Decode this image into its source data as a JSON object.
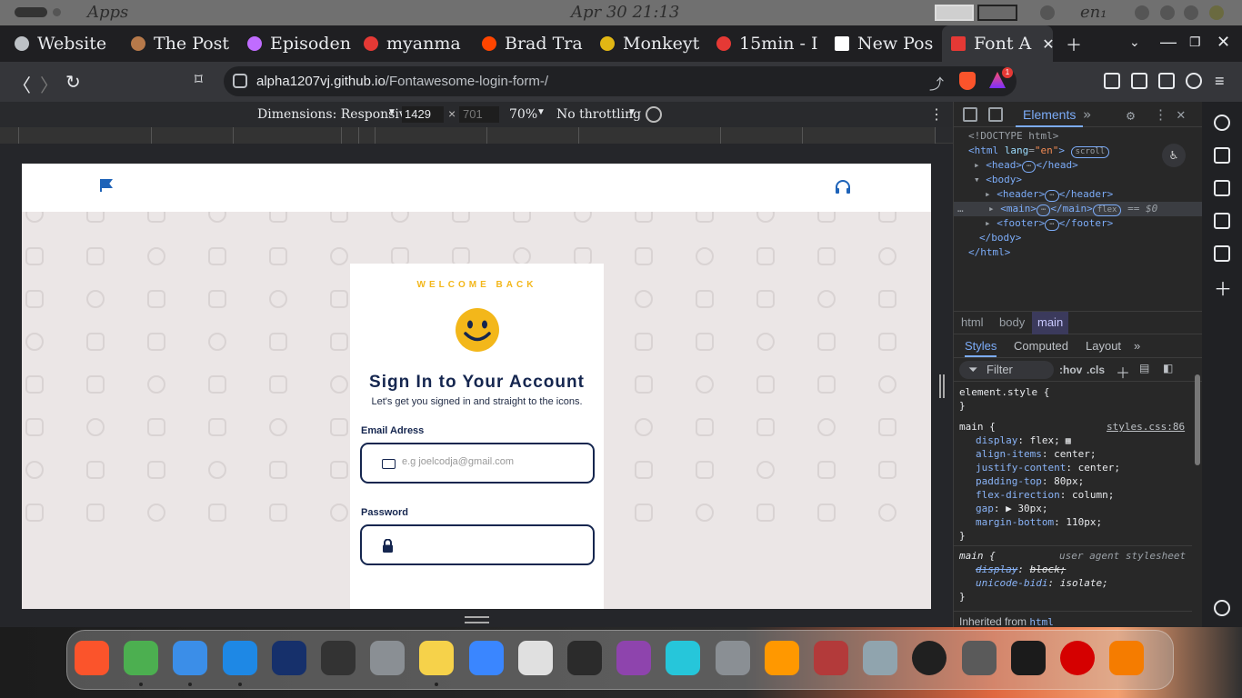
{
  "system_bar": {
    "apps_label": "Apps",
    "datetime": "Apr 30  21:13",
    "lang": "en₁"
  },
  "tabs": [
    {
      "label": "Website",
      "icon": "website-icon",
      "color": "#bdc1c6"
    },
    {
      "label": "The Post",
      "icon": "monkey-icon",
      "color": "#b6794a"
    },
    {
      "label": "Episoden",
      "icon": "infinity-icon",
      "color": "#c06cff"
    },
    {
      "label": "myanma",
      "icon": "shield-icon",
      "color": "#e53935"
    },
    {
      "label": "Brad Tra",
      "icon": "reddit-icon",
      "color": "#ff4500"
    },
    {
      "label": "Monkeyt",
      "icon": "monkeytype-icon",
      "color": "#e2b714"
    },
    {
      "label": "15min - I",
      "icon": "shield-icon",
      "color": "#e53935"
    },
    {
      "label": "New Pos",
      "icon": "dev-icon",
      "color": "#ffffff"
    },
    {
      "label": "Font A",
      "icon": "font-icon",
      "color": "#e53935",
      "active": true
    }
  ],
  "address": {
    "host": "alpha1207vj.github.io",
    "path": "/Fontawesome-login-form-/",
    "badge_count": "1"
  },
  "device_toolbar": {
    "dimensions_label": "Dimensions: Responsive",
    "width": "1429",
    "height_placeholder": "701",
    "zoom": "70%",
    "throttling": "No throttling"
  },
  "page": {
    "welcome": "WELCOME BACK",
    "title": "Sign In to Your Account",
    "subtitle": "Let's get you signed in and straight to the icons.",
    "email_label": "Email Adress",
    "email_placeholder": "e.g joelcodja@gmail.com",
    "password_label": "Password",
    "accent": "#f3b71a",
    "brand": "#15264f"
  },
  "devtools": {
    "elements_tab": "Elements",
    "dom": {
      "doctype": "<!DOCTYPE html>",
      "html_open": "<html",
      "lang_attr": "lang",
      "lang_val": "\"en\"",
      "scroll_badge": "scroll",
      "head": "<head>",
      "head_close": "</head>",
      "body": "<body>",
      "header": "<header>",
      "header_close": "</header>",
      "main": "<main>",
      "main_close": "</main>",
      "flex_badge": "flex",
      "selected_marker": "== $0",
      "footer": "<footer>",
      "footer_close": "</footer>",
      "body_close": "</body>",
      "html_close": "</html>",
      "ellipsis": "⋯",
      "row_menu": "…"
    },
    "breadcrumbs": [
      "html",
      "body",
      "main"
    ],
    "style_tabs": [
      "Styles",
      "Computed",
      "Layout"
    ],
    "filter_placeholder": "Filter",
    "hov": ":hov",
    "cls": ".cls",
    "element_style": "element.style {",
    "close_brace": "}",
    "main_rule": {
      "selector": "main {",
      "source": "styles.css:86",
      "declarations": [
        {
          "prop": "display",
          "value": "flex;"
        },
        {
          "prop": "align-items",
          "value": "center;"
        },
        {
          "prop": "justify-content",
          "value": "center;"
        },
        {
          "prop": "padding-top",
          "value": "80px;"
        },
        {
          "prop": "flex-direction",
          "value": "column;"
        },
        {
          "prop": "gap",
          "value": "▶ 30px;"
        },
        {
          "prop": "margin-bottom",
          "value": "110px;"
        }
      ]
    },
    "ua_rule": {
      "selector": "main {",
      "source": "user agent stylesheet",
      "declarations": [
        {
          "prop": "display",
          "value": "block;"
        },
        {
          "prop": "unicode-bidi",
          "value": "isolate;"
        }
      ]
    },
    "inherited_label": "Inherited from",
    "inherited_from": "html"
  },
  "dock": [
    {
      "name": "brave-icon",
      "color": "#fb542b"
    },
    {
      "name": "chrome-icon",
      "color": "#4caf50"
    },
    {
      "name": "finder-icon",
      "color": "#3b8ee8"
    },
    {
      "name": "vscode-icon",
      "color": "#1e88e5"
    },
    {
      "name": "cross-icon",
      "color": "#16306b"
    },
    {
      "name": "command-icon",
      "color": "#333333"
    },
    {
      "name": "settings-icon",
      "color": "#8a8f94"
    },
    {
      "name": "notes-icon",
      "color": "#f6d24a"
    },
    {
      "name": "puzzle-icon",
      "color": "#3a86ff"
    },
    {
      "name": "preview-icon",
      "color": "#e0e0e0"
    },
    {
      "name": "tuxedo-icon",
      "color": "#2b2b2b"
    },
    {
      "name": "siri-icon",
      "color": "#8e44ad"
    },
    {
      "name": "flower-icon",
      "color": "#26c6da"
    },
    {
      "name": "system-prefs-icon",
      "color": "#8a8f94"
    },
    {
      "name": "books-icon",
      "color": "#ff9800"
    },
    {
      "name": "dictionary-icon",
      "color": "#b33a3a"
    },
    {
      "name": "screenshot-icon",
      "color": "#90a4ae"
    },
    {
      "name": "obs-icon",
      "color": "#202020"
    },
    {
      "name": "calculator-icon",
      "color": "#5a5a5a"
    },
    {
      "name": "terminal-icon",
      "color": "#1b1b1b"
    },
    {
      "name": "record-icon",
      "color": "#d50000"
    },
    {
      "name": "launchpad-icon",
      "color": "#f57c00"
    }
  ]
}
